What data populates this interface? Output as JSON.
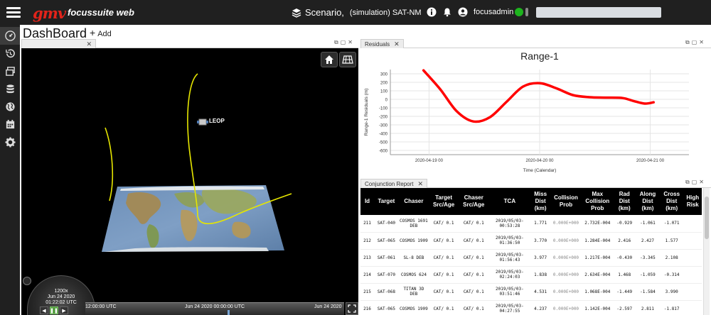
{
  "header": {
    "logo_brand": "gmv",
    "logo_product": "focussuite web",
    "scenario_label": "Scenario,",
    "scenario_value": "(simulation) SAT-NM",
    "username": "focusadmin"
  },
  "sidebar": {
    "items": [
      {
        "icon": "dashboard-icon"
      },
      {
        "icon": "history-icon"
      },
      {
        "icon": "windows-icon"
      },
      {
        "icon": "database-icon"
      },
      {
        "icon": "globe-icon"
      },
      {
        "icon": "calendar-icon"
      },
      {
        "icon": "gear-icon"
      }
    ]
  },
  "page": {
    "title": "DashBoard",
    "add_label": "Add"
  },
  "viewer": {
    "satellite_label": "LEOP",
    "clock_speed": "1200x",
    "clock_date": "Jun 24 2020",
    "clock_time": "01:22:02 UTC",
    "timeline_labels": [
      "12:00:00 UTC",
      "Jun 24 2020 00:00:00 UTC",
      "Jun 24 2020"
    ]
  },
  "residuals": {
    "tab_label": "Residuals"
  },
  "chart_data": {
    "type": "line",
    "title": "Range-1",
    "xlabel": "Time (Calendar)",
    "ylabel": "Range-1 Residuals (m)",
    "ylim": [
      -650,
      350
    ],
    "yticks": [
      300,
      200,
      100,
      0,
      -100,
      -200,
      -300,
      -400,
      -500,
      -600
    ],
    "xtick_labels": [
      "2020-04-19 00",
      "2020-04-20 00",
      "2020-04-21 00"
    ],
    "series": [
      {
        "color": "#ff0000",
        "x": [
          -0.05,
          0.1,
          0.25,
          0.4,
          0.55,
          0.7,
          0.85,
          1.0,
          1.15,
          1.3,
          1.45,
          1.6,
          1.75,
          1.85,
          1.95,
          2.03
        ],
        "values": [
          340,
          120,
          -140,
          -260,
          -210,
          -30,
          150,
          190,
          130,
          50,
          25,
          20,
          15,
          -20,
          -50,
          -35
        ]
      }
    ],
    "grid": true
  },
  "report": {
    "tab_label": "Conjunction Report",
    "columns": [
      "Id",
      "Target",
      "Chaser",
      "Target Src/Age",
      "Chaser Src/Age",
      "TCA",
      "Miss Dist (km)",
      "Collision Prob",
      "Max Collision Prob",
      "Rad Dist (km)",
      "Along Dist (km)",
      "Cross Dist (km)",
      "High Risk"
    ],
    "rows": [
      [
        "211",
        "SAT-040",
        "COSMOS 1691 DEB",
        "CAT/ 0.1",
        "CAT/ 0.1",
        "2019/05/03-00:53:28",
        "1.771",
        "0.000E+000",
        "2.732E-004",
        "-0.929",
        "-1.061",
        "-1.071",
        ""
      ],
      [
        "212",
        "SAT-065",
        "COSMOS 1909",
        "CAT/ 0.1",
        "CAT/ 0.1",
        "2019/05/03-01:36:50",
        "3.770",
        "0.000E+000",
        "1.284E-004",
        "2.416",
        "2.427",
        "1.577",
        ""
      ],
      [
        "213",
        "SAT-061",
        "SL-8 DEB",
        "CAT/ 0.1",
        "CAT/ 0.1",
        "2019/05/03-01:56:43",
        "3.977",
        "0.000E+000",
        "1.217E-004",
        "-0.430",
        "-3.345",
        "2.108",
        ""
      ],
      [
        "214",
        "SAT-070",
        "COSMOS 624",
        "CAT/ 0.1",
        "CAT/ 0.1",
        "2019/05/03-02:24:03",
        "1.838",
        "0.000E+000",
        "2.634E-004",
        "1.468",
        "-1.059",
        "-0.314",
        ""
      ],
      [
        "215",
        "SAT-068",
        "TITAN 3D DEB",
        "CAT/ 0.1",
        "CAT/ 0.1",
        "2019/05/03-03:51:46",
        "4.531",
        "0.000E+000",
        "1.068E-004",
        "-1.449",
        "-1.584",
        "3.990",
        ""
      ],
      [
        "216",
        "SAT-065",
        "COSMOS 1909",
        "CAT/ 0.1",
        "CAT/ 0.1",
        "2019/05/03-04:27:55",
        "4.237",
        "0.000E+000",
        "1.142E-004",
        "-2.597",
        "2.811",
        "-1.817",
        ""
      ]
    ]
  },
  "colors": {
    "topbar": "#202020",
    "brand_red": "#e2231a",
    "orbit": "#e6e600",
    "series": "#ff0000",
    "status_green": "#1db41d"
  }
}
